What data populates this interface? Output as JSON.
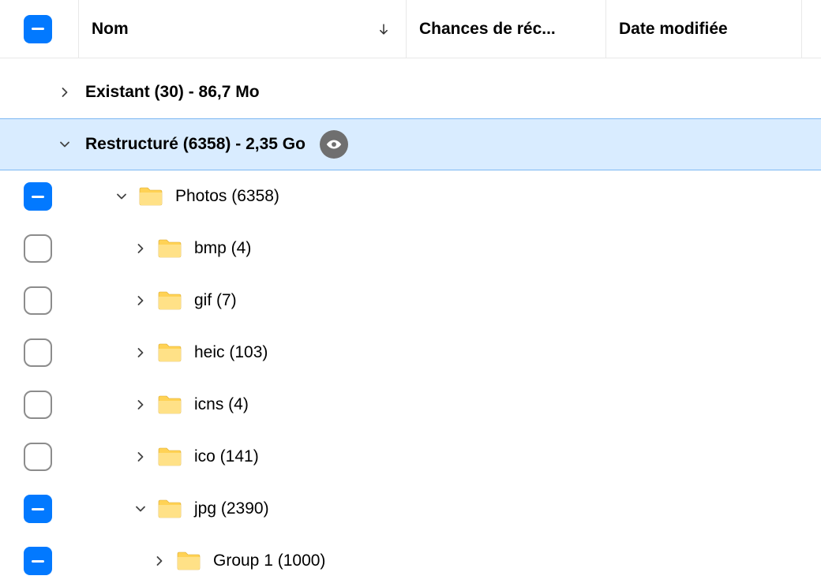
{
  "columns": {
    "name": "Nom",
    "chance": "Chances de réc...",
    "date": "Date modifiée"
  },
  "rows": {
    "existing": "Existant (30) - 86,7 Mo",
    "restructured": "Restructuré (6358) - 2,35 Go",
    "photos": "Photos (6358)",
    "bmp": "bmp (4)",
    "gif": "gif (7)",
    "heic": "heic (103)",
    "icns": "icns (4)",
    "ico": "ico (141)",
    "jpg": "jpg (2390)",
    "group1": "Group 1 (1000)"
  }
}
